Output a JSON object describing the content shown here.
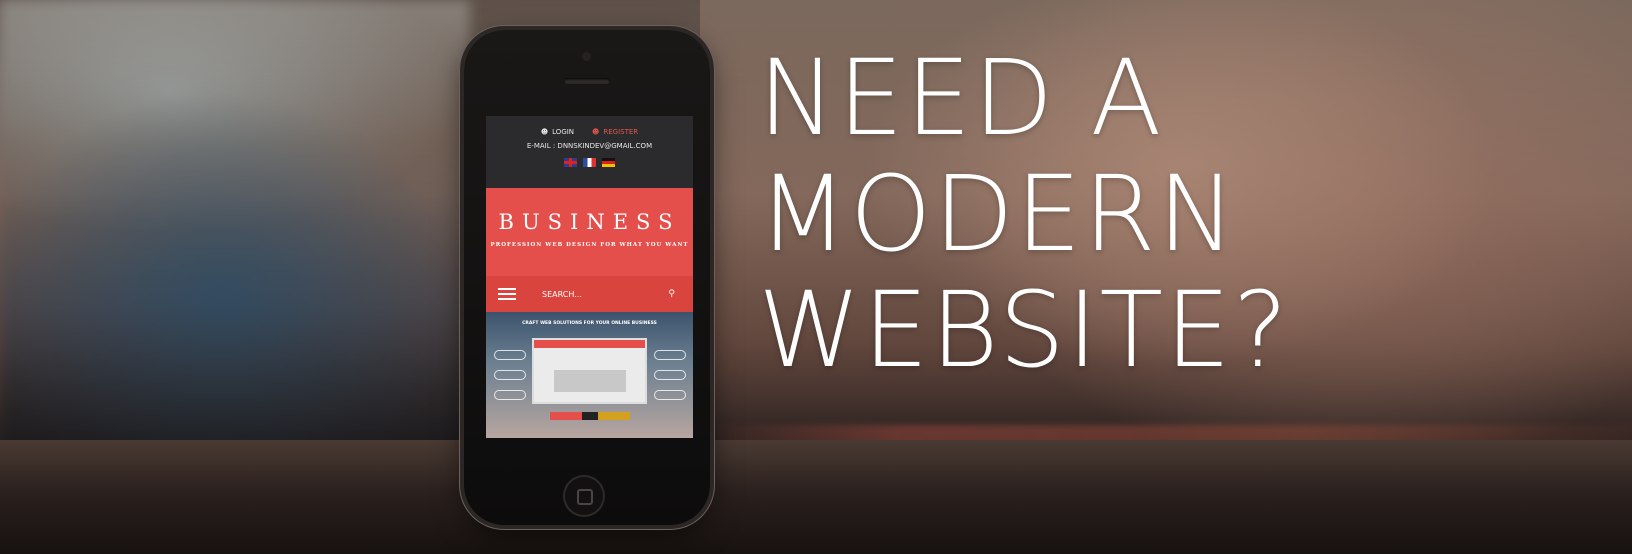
{
  "headline": {
    "line1": "NEED A",
    "line2": "MODERN",
    "line3": "WEBSITE?"
  },
  "phone_site": {
    "login_label": "LOGIN",
    "register_label": "REGISTER",
    "email_line": "E-MAIL : DNNSKINDEV@GMAIL.COM",
    "languages": [
      "English",
      "Français",
      "Deutsch"
    ],
    "brand": "BUSINESS",
    "tagline": "PROFESSION WEB DESIGN FOR WHAT YOU WANT",
    "search_placeholder": "SEARCH...",
    "showcase_caption": "CRAFT WEB SOLUTIONS FOR YOUR ONLINE BUSINESS"
  },
  "colors": {
    "brand_red": "#e44f4b",
    "nav_red": "#d9443f",
    "top_bar": "#2b2a2c",
    "headline_text": "#ffffff"
  },
  "icons": [
    "user-icon",
    "register-user-icon",
    "uk-flag-icon",
    "fr-flag-icon",
    "de-flag-icon",
    "menu-icon",
    "search-icon"
  ]
}
